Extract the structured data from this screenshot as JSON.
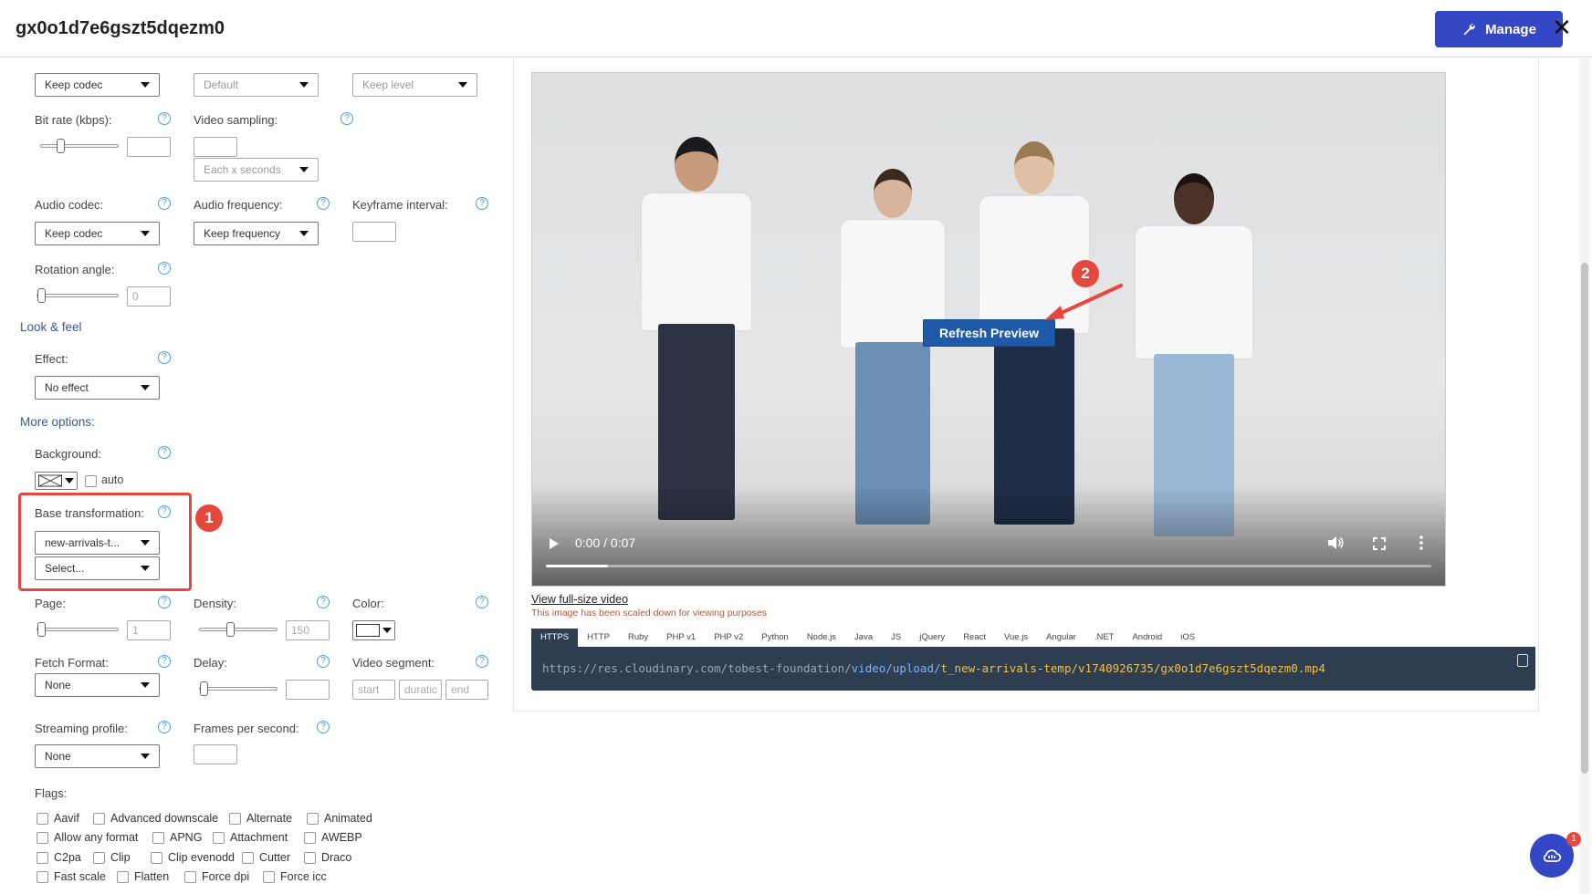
{
  "header": {
    "title": "gx0o1d7e6gszt5dqezm0",
    "manage_label": "Manage",
    "close_glyph": "✕"
  },
  "form": {
    "video_codec_value": "Keep codec",
    "profile_value": "Default",
    "level_value": "Keep level",
    "bit_rate_label": "Bit rate (kbps):",
    "video_sampling_label": "Video sampling:",
    "video_sampling_select": "Each x seconds",
    "audio_codec_label": "Audio codec:",
    "audio_codec_value": "Keep codec",
    "audio_frequency_label": "Audio frequency:",
    "audio_frequency_value": "Keep frequency",
    "keyframe_label": "Keyframe interval:",
    "rotation_label": "Rotation angle:",
    "rotation_value": "0",
    "look_feel_label": "Look & feel",
    "effect_label": "Effect:",
    "effect_value": "No effect",
    "more_options_label": "More options:",
    "background_label": "Background:",
    "auto_label": "auto",
    "base_transformation_label": "Base transformation:",
    "base_transformation_value": "new-arrivals-t...",
    "base_transformation_select": "Select...",
    "page_label": "Page:",
    "page_value": "1",
    "density_label": "Density:",
    "density_value": "150",
    "color_label": "Color:",
    "fetch_format_label": "Fetch Format:",
    "fetch_format_value": "None",
    "delay_label": "Delay:",
    "video_segment_label": "Video segment:",
    "segment_start": "start",
    "segment_duration": "duratic",
    "segment_end": "end",
    "streaming_profile_label": "Streaming profile:",
    "streaming_profile_value": "None",
    "fps_label": "Frames per second:",
    "flags_label": "Flags:",
    "help_glyph": "?",
    "sliders": {
      "bit_rate": 0.22,
      "rotation": 0.0,
      "page": 0.0,
      "density": 0.38,
      "delay": 0.0
    }
  },
  "flags": [
    [
      "Aavif",
      "Advanced downscale",
      "Alternate",
      "Animated"
    ],
    [
      "Allow any format",
      "APNG",
      "Attachment",
      "AWEBP"
    ],
    [
      "C2pa",
      "Clip",
      "Clip evenodd",
      "Cutter",
      "Draco"
    ],
    [
      "Fast scale",
      "Flatten",
      "Force dpi",
      "Force icc"
    ]
  ],
  "annotations": {
    "badge1": "1",
    "badge2": "2"
  },
  "preview": {
    "refresh_label": "Refresh Preview",
    "time": "0:00 / 0:07",
    "progress": 0.07,
    "view_full": "View full-size video",
    "scaled_note": "This image has been scaled down for viewing purposes",
    "code_tabs": [
      "HTTPS",
      "HTTP",
      "Ruby",
      "PHP v1",
      "PHP v2",
      "Python",
      "Node.js",
      "Java",
      "JS",
      "jQuery",
      "React",
      "Vue.js",
      "Angular",
      ".NET",
      "Android",
      "iOS"
    ],
    "active_tab": "HTTPS",
    "url_part1": "https://res.cloudinary.com/tobest-foundation/",
    "url_part2": "video/upload/",
    "url_part3": "t_new-arrivals-temp/",
    "url_part4": "v1740926735/gx0o1d7e6gszt5dqezm0.mp4"
  },
  "chat": {
    "badge": "1"
  },
  "colors": {
    "accent": "#3448c5",
    "highlight": "#e5483f",
    "code_bg": "#2c3e50",
    "refresh": "#1e5aa8"
  }
}
